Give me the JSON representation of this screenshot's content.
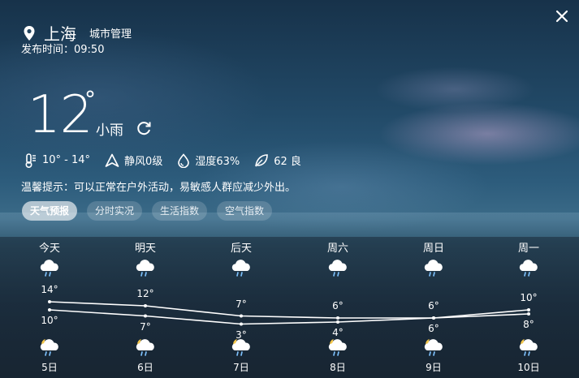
{
  "location": {
    "city": "上海",
    "manage_label": "城市管理",
    "publish_time": "发布时间：09:50"
  },
  "current": {
    "temperature": "12",
    "degree_symbol": "°",
    "condition": "小雨",
    "temp_range": "10° - 14°",
    "wind": "静风0级",
    "humidity": "湿度63%",
    "aqi": "62 良",
    "tip": "温馨提示：可以正常在户外活动，易敏感人群应减少外出。"
  },
  "tabs": [
    {
      "label": "天气预报",
      "active": true
    },
    {
      "label": "分时实况",
      "active": false
    },
    {
      "label": "生活指数",
      "active": false
    },
    {
      "label": "空气指数",
      "active": false
    }
  ],
  "forecast": [
    {
      "day": "今天",
      "high": 14,
      "low": 10,
      "high_label": "14°",
      "low_label": "10°",
      "date": "5日"
    },
    {
      "day": "明天",
      "high": 12,
      "low": 7,
      "high_label": "12°",
      "low_label": "7°",
      "date": "6日"
    },
    {
      "day": "后天",
      "high": 7,
      "low": 3,
      "high_label": "7°",
      "low_label": "3°",
      "date": "7日"
    },
    {
      "day": "周六",
      "high": 6,
      "low": 4,
      "high_label": "6°",
      "low_label": "4°",
      "date": "8日"
    },
    {
      "day": "周日",
      "high": 6,
      "low": 6,
      "high_label": "6°",
      "low_label": "6°",
      "date": "9日"
    },
    {
      "day": "周一",
      "high": 10,
      "low": 8,
      "high_label": "10°",
      "low_label": "8°",
      "date": "10日"
    }
  ],
  "icons": {
    "close": "close-icon",
    "location": "location-pin-icon",
    "refresh": "refresh-icon",
    "thermometer": "thermometer-icon",
    "wind": "wind-arrow-icon",
    "humidity": "water-drop-icon",
    "aqi": "leaf-icon",
    "day_weather": "rain-cloud-icon",
    "night_weather": "moon-rain-cloud-icon"
  }
}
